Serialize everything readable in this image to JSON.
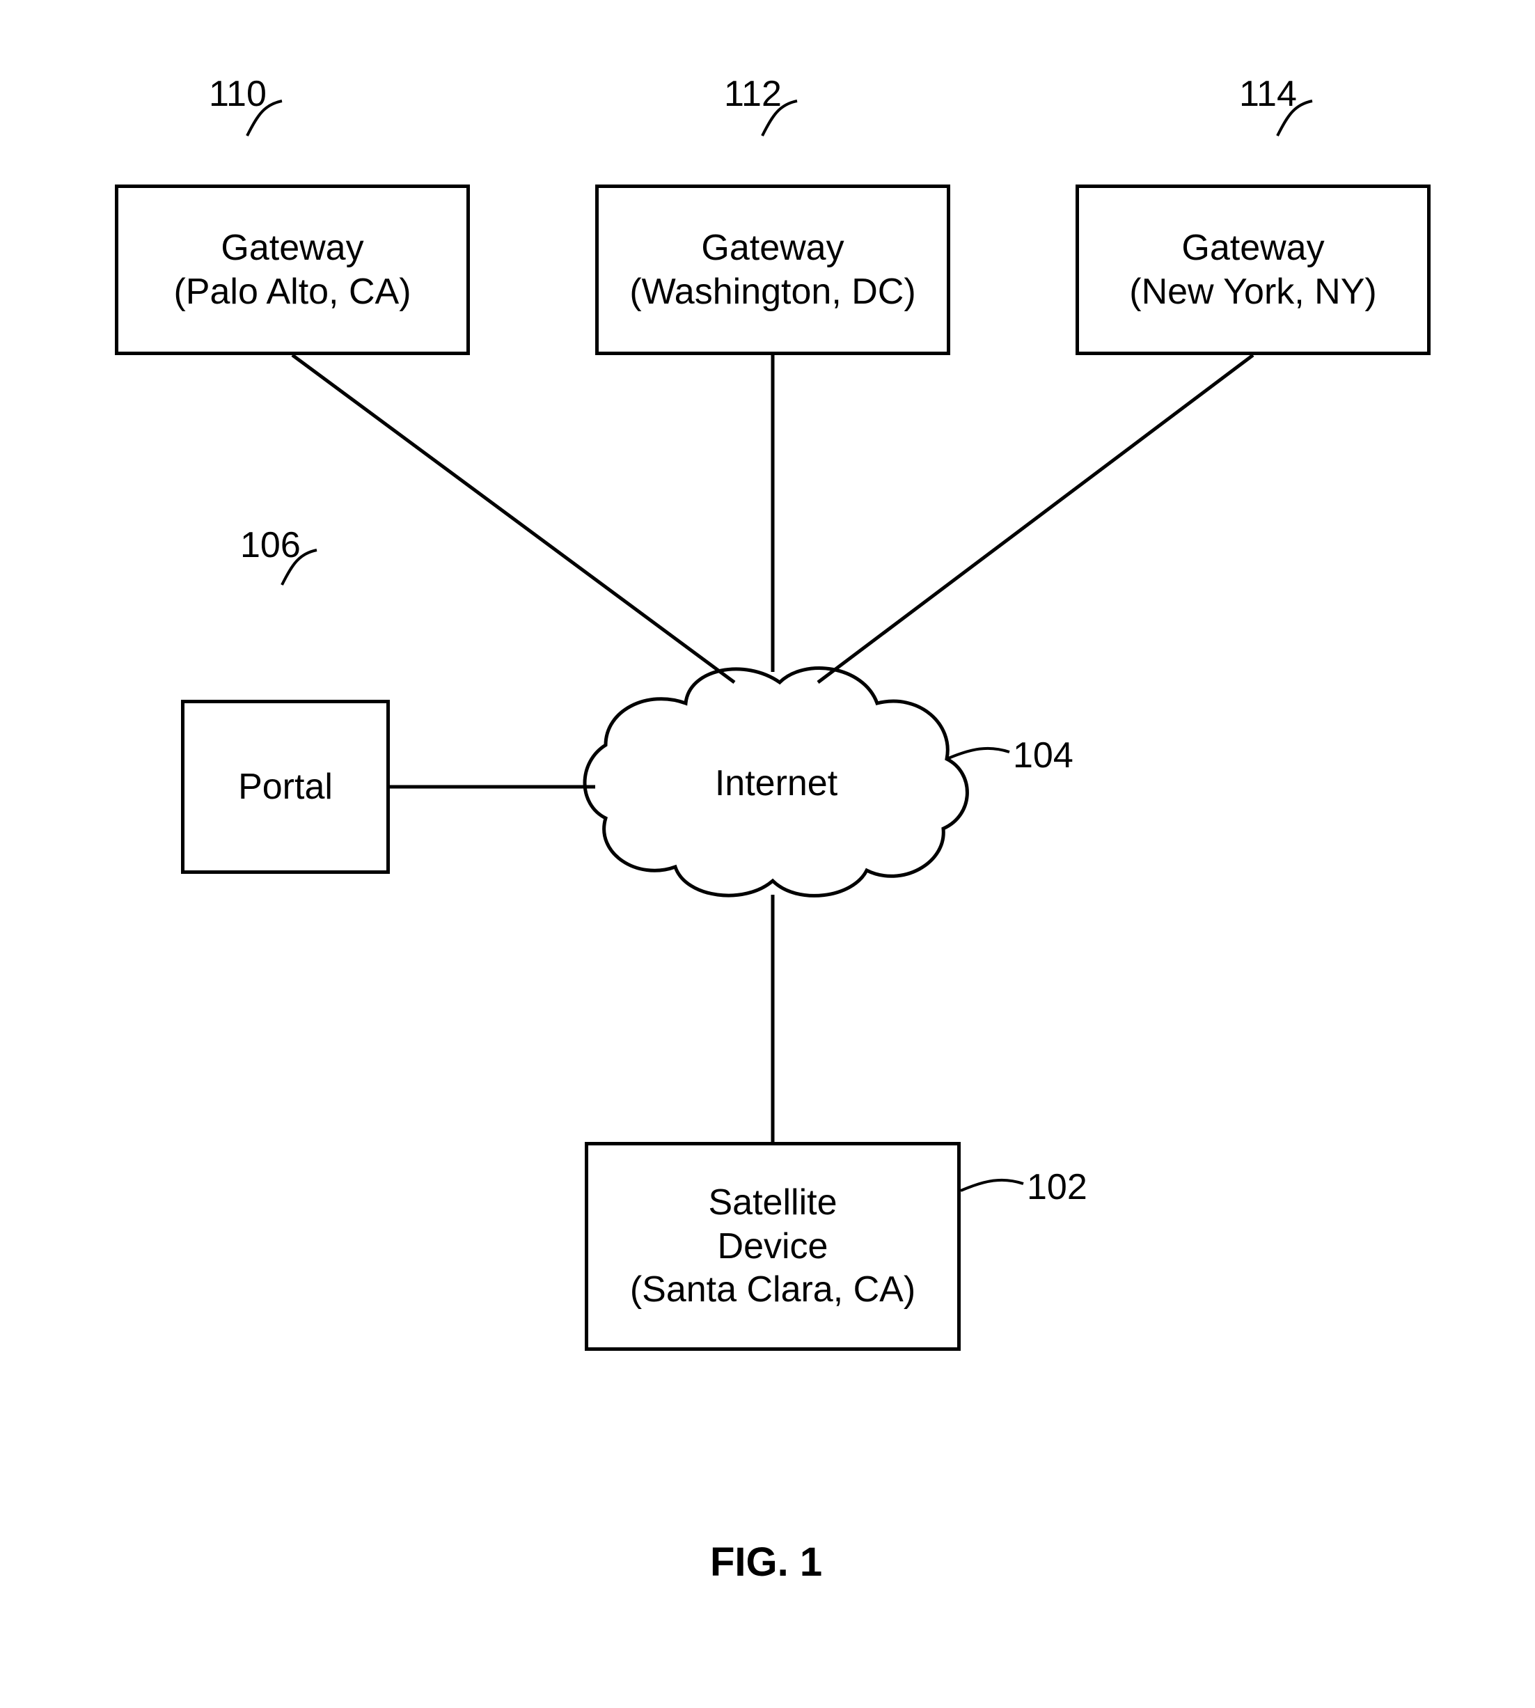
{
  "nodes": {
    "gw1": {
      "ref": "110",
      "line1": "Gateway",
      "line2": "(Palo Alto, CA)"
    },
    "gw2": {
      "ref": "112",
      "line1": "Gateway",
      "line2": "(Washington, DC)"
    },
    "gw3": {
      "ref": "114",
      "line1": "Gateway",
      "line2": "(New York, NY)"
    },
    "portal": {
      "ref": "106",
      "label": "Portal"
    },
    "cloud": {
      "ref": "104",
      "label": "Internet"
    },
    "sat": {
      "ref": "102",
      "line1": "Satellite",
      "line2": "Device",
      "line3": "(Santa Clara, CA)"
    }
  },
  "caption": "FIG. 1"
}
